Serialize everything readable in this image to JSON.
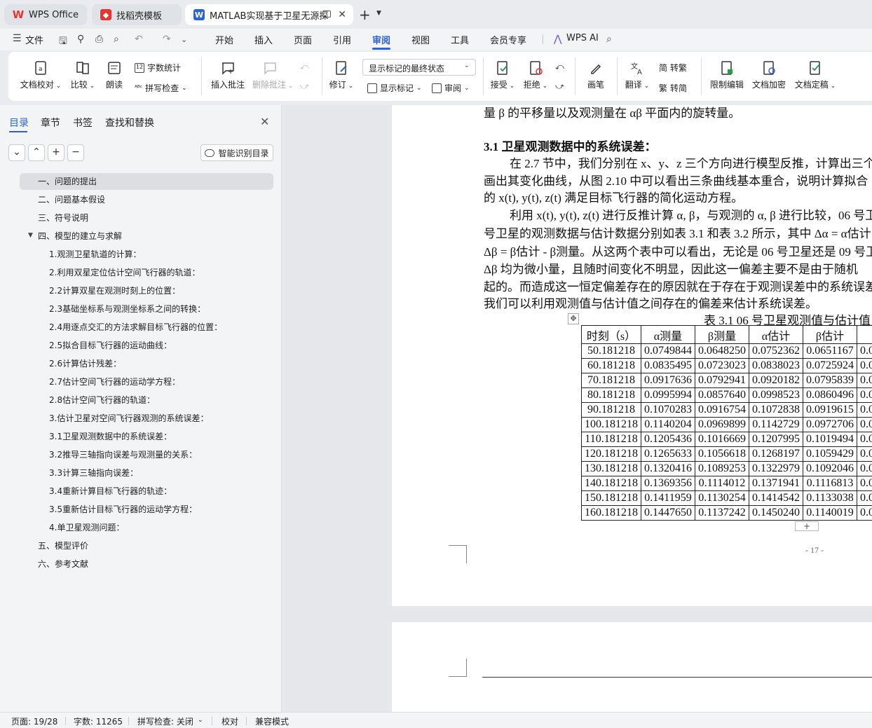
{
  "tabs": [
    {
      "label": "WPS Office",
      "icon": "wps-logo-icon"
    },
    {
      "label": "找稻壳模板",
      "icon": "docer-icon"
    },
    {
      "label": "MATLAB实现基于卫星无源探",
      "icon": "word-doc-icon"
    }
  ],
  "menu": {
    "file": "文件",
    "items": [
      "开始",
      "插入",
      "页面",
      "引用",
      "审阅",
      "视图",
      "工具",
      "会员专享"
    ],
    "active": "审阅",
    "wps_ai": "WPS AI"
  },
  "ribbon": {
    "doc_check": "文档校对",
    "compare": "比较",
    "read_aloud": "朗读",
    "word_count": "字数统计",
    "spell_check": "拼写检查",
    "insert_comment": "插入批注",
    "delete_comment": "删除批注",
    "revise": "修订",
    "markup_select": "显示标记的最终状态",
    "show_markup": "显示标记",
    "review_pane": "审阅",
    "accept": "接受",
    "reject": "拒绝",
    "pen": "画笔",
    "translate": "翻译",
    "to_traditional": "转繁",
    "to_simplified": "转简",
    "restrict_edit": "限制编辑",
    "encrypt": "文档加密",
    "finalize": "文档定稿"
  },
  "nav": {
    "tabs": [
      "目录",
      "章节",
      "书签",
      "查找和替换"
    ],
    "active_tab": "目录",
    "smart_toc": "智能识别目录",
    "toc": [
      {
        "label": "一、问题的提出",
        "level": 1,
        "selected": true
      },
      {
        "label": "二、问题基本假设",
        "level": 1
      },
      {
        "label": "三、符号说明",
        "level": 1
      },
      {
        "label": "四、模型的建立与求解",
        "level": 1,
        "expanded": true
      },
      {
        "label": "1.观测卫星轨道的计算：",
        "level": 2
      },
      {
        "label": "2.利用双星定位估计空间飞行器的轨道：",
        "level": 2
      },
      {
        "label": "2.2计算双星在观测时刻上的位置：",
        "level": 2
      },
      {
        "label": "2.3基础坐标系与观测坐标系之间的转换：",
        "level": 2
      },
      {
        "label": "2.4用逐点交汇的方法求解目标飞行器的位置：",
        "level": 2
      },
      {
        "label": "2.5拟合目标飞行器的运动曲线：",
        "level": 2
      },
      {
        "label": "2.6计算估计残差：",
        "level": 2
      },
      {
        "label": "2.7估计空间飞行器的运动学方程：",
        "level": 2
      },
      {
        "label": "2.8估计空间飞行器的轨道：",
        "level": 2
      },
      {
        "label": "3.估计卫星对空间飞行器观测的系统误差：",
        "level": 2
      },
      {
        "label": "3.1卫星观测数据中的系统误差：",
        "level": 2
      },
      {
        "label": "3.2推导三轴指向误差与观测量的关系：",
        "level": 2
      },
      {
        "label": "3.3计算三轴指向误差：",
        "level": 2
      },
      {
        "label": "3.4重新计算目标飞行器的轨迹：",
        "level": 2
      },
      {
        "label": "3.5重新估计目标飞行器的运动学方程：",
        "level": 2
      },
      {
        "label": "4.单卫星观测问题：",
        "level": 2
      },
      {
        "label": "五、模型评价",
        "level": 1
      },
      {
        "label": "六、参考文献",
        "level": 1
      }
    ]
  },
  "doc": {
    "line0": "量  β 的平移量以及观测量在 αβ 平面内的旋转量。",
    "heading": "3.1   卫星观测数据中的系统误差：",
    "p1": "在 2.7 节中，我们分别在 x、y、z 三个方向进行模型反推，计算出三个 k,j",
    "p2": "画出其变化曲线，从图 2.10 中可以看出三条曲线基本重合，说明计算拟合",
    "p3": "的 x(t), y(t), z(t) 满足目标飞行器的简化运动方程。",
    "p4": "利用 x(t), y(t), z(t) 进行反推计算 α, β，与观测的 α, β 进行比较，06 号卫",
    "p5": "号卫星的观测数据与估计数据分别如表 3.1 和表 3.2 所示，其中 Δα = α估计",
    "p6": "Δβ = β估计 - β测量。从这两个表中可以看出，无论是 06 号卫星还是 09 号卫星",
    "p7": "Δβ 均为微小量，且随时间变化不明显，因此这一偏差主要不是由于随机",
    "p8": "起的。而造成这一恒定偏差存在的原因就在于存在于观测误差中的系统误差",
    "p9": "我们可以利用观测值与估计值之间存在的偏差来估计系统误差。",
    "caption": "表 3.1 06 号卫星观测值与估计值比较",
    "table_headers": [
      "时刻（s）",
      "α测量",
      "β测量",
      "α估计",
      "β估计",
      "Δα",
      ""
    ],
    "table_rows": [
      [
        "50.181218",
        "0.0749844",
        "0.0648250",
        "0.0752362",
        "0.0651167",
        "0.0002518",
        "0"
      ],
      [
        "60.181218",
        "0.0835495",
        "0.0723023",
        "0.0838023",
        "0.0725924",
        "0.0002527",
        "0"
      ],
      [
        "70.181218",
        "0.0917636",
        "0.0792941",
        "0.0920182",
        "0.0795839",
        "0.0002545",
        "0"
      ],
      [
        "80.181218",
        "0.0995994",
        "0.0857640",
        "0.0998523",
        "0.0860496",
        "0.0002529",
        "0"
      ],
      [
        "90.181218",
        "0.1070283",
        "0.0916754",
        "0.1072838",
        "0.0919615",
        "0.0002555",
        "0"
      ],
      [
        "100.181218",
        "0.1140204",
        "0.0969899",
        "0.1142729",
        "0.0972706",
        "0.0002525",
        "0"
      ],
      [
        "110.181218",
        "0.1205436",
        "0.1016669",
        "0.1207995",
        "0.1019494",
        "0.0002559",
        "0"
      ],
      [
        "120.181218",
        "0.1265633",
        "0.1056618",
        "0.1268197",
        "0.1059429",
        "0.0002563",
        "0"
      ],
      [
        "130.181218",
        "0.1320416",
        "0.1089253",
        "0.1322979",
        "0.1092046",
        "0.0002563",
        "0"
      ],
      [
        "140.181218",
        "0.1369356",
        "0.1114012",
        "0.1371941",
        "0.1116813",
        "0.0002585",
        "0"
      ],
      [
        "150.181218",
        "0.1411959",
        "0.1130254",
        "0.1414542",
        "0.1133038",
        "0.0002582",
        "0"
      ],
      [
        "160.181218",
        "0.1447650",
        "0.1137242",
        "0.1450240",
        "0.1140019",
        "0.0002589",
        "0"
      ]
    ],
    "page_number": "- 17 -"
  },
  "status": {
    "page": "页面: 19/28",
    "words": "字数: 11265",
    "spell": "拼写检查: 关闭",
    "proof": "校对",
    "compat": "兼容模式"
  },
  "colors": {
    "accent": "#2b64d6",
    "wps_red": "#e8342f"
  }
}
